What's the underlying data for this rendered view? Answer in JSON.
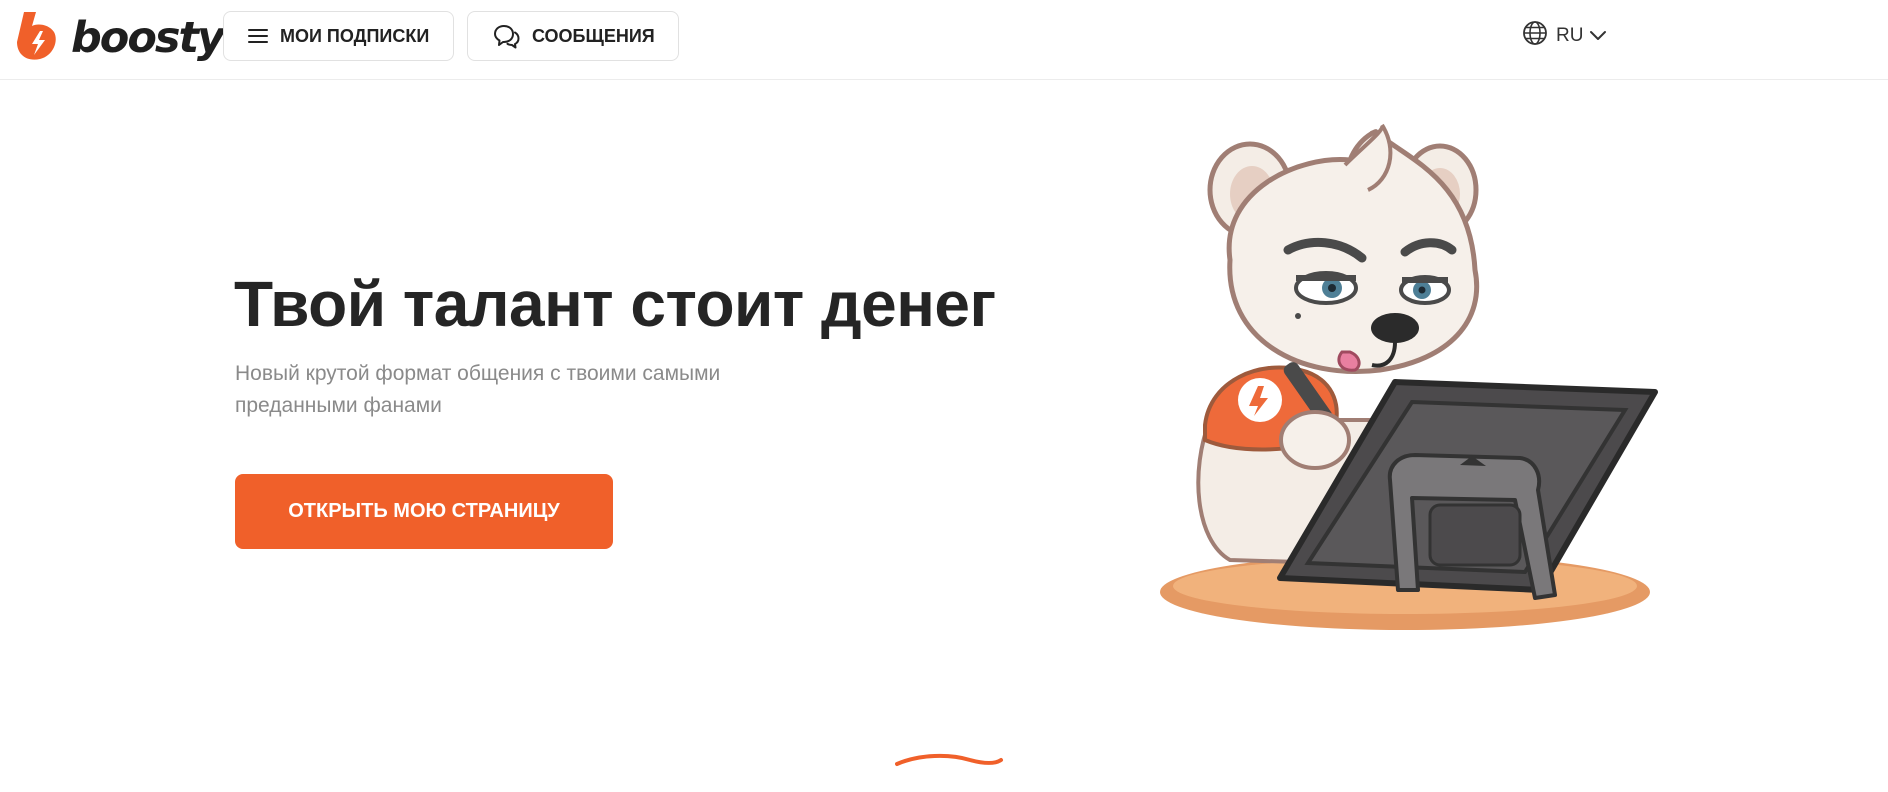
{
  "header": {
    "logo_text": "boosty",
    "subscriptions_label": "МОИ ПОДПИСКИ",
    "messages_label": "СООБЩЕНИЯ",
    "language": "RU",
    "icons": {
      "logo": "boosty-logo-icon",
      "subscriptions": "hamburger-menu-icon",
      "messages": "chat-bubbles-icon",
      "language": "globe-icon",
      "language_toggle": "chevron-down-icon"
    }
  },
  "hero": {
    "title": "Твой талант стоит денег",
    "subtitle": "Новый крутой формат общения с твоими самыми преданными фанами",
    "cta_label": "ОТКРЫТЬ МОЮ СТРАНИЦУ",
    "illustration": "polar-bear-drawing-tablet-illustration"
  },
  "colors": {
    "accent": "#f0602a",
    "text": "#252525",
    "muted": "#8a8a8a",
    "border": "#e1e1e1"
  }
}
